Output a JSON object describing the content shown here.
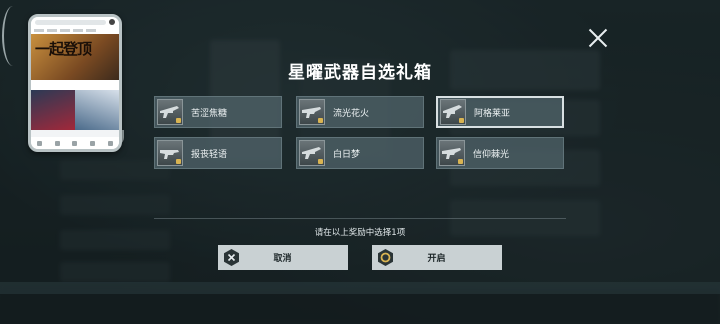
{
  "dialog": {
    "title": "星曜武器自选礼箱",
    "hint": "请在以上奖励中选择1项",
    "cancel_label": "取消",
    "open_label": "开启"
  },
  "rewards": [
    {
      "label": "苦涩焦糖",
      "selected": false
    },
    {
      "label": "流光花火",
      "selected": false
    },
    {
      "label": "阿格莱亚",
      "selected": true
    },
    {
      "label": "报丧轻语",
      "selected": false
    },
    {
      "label": "白日梦",
      "selected": false
    },
    {
      "label": "信仰棘光",
      "selected": false
    }
  ],
  "phone_preview": {
    "banner_text": "一起登顶"
  },
  "colors": {
    "item_bg": "#4e6268",
    "button_bg": "#c9d1d3",
    "rarity_gold": "#d9b452",
    "open_icon_ring": "#d9b452"
  }
}
